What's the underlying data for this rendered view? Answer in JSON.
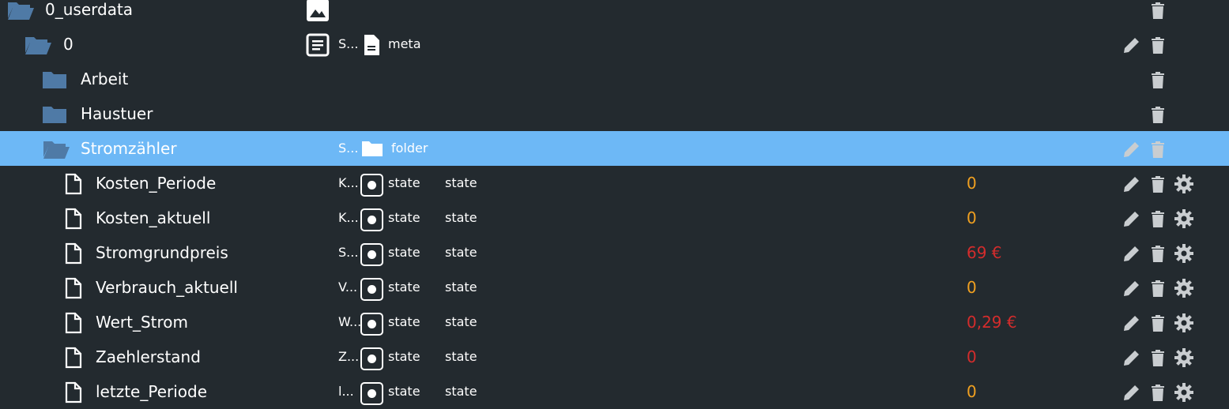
{
  "colors": {
    "background": "#232a2f",
    "selected_row": "#6db8f6",
    "folder_icon": "#4f7aa6",
    "action_icon": "#c9cdd0",
    "value_orange": "#f0a020",
    "value_red": "#d42c2c"
  },
  "rows": [
    {
      "name": "0_userdata",
      "icon": "folder-open-icon",
      "type_icon": "image-icon"
    },
    {
      "name": "0",
      "icon": "folder-open-icon",
      "label": "S...",
      "type_icon": "document-icon",
      "type_label": "meta"
    },
    {
      "name": "Arbeit",
      "icon": "folder-icon"
    },
    {
      "name": "Haustuer",
      "icon": "folder-icon"
    },
    {
      "name": "Stromzähler",
      "icon": "folder-open-icon",
      "label": "S...",
      "type_icon": "folder-icon",
      "type_label": "folder",
      "selected": true
    },
    {
      "name": "Kosten_Periode",
      "icon": "file-icon",
      "label": "K...",
      "type_label": "state",
      "role": "state",
      "value": "0",
      "value_color": "orange"
    },
    {
      "name": "Kosten_aktuell",
      "icon": "file-icon",
      "label": "K...",
      "type_label": "state",
      "role": "state",
      "value": "0",
      "value_color": "orange"
    },
    {
      "name": "Stromgrundpreis",
      "icon": "file-icon",
      "label": "S...",
      "type_label": "state",
      "role": "state",
      "value": "69 €",
      "value_color": "red"
    },
    {
      "name": "Verbrauch_aktuell",
      "icon": "file-icon",
      "label": "V...",
      "type_label": "state",
      "role": "state",
      "value": "0",
      "value_color": "orange"
    },
    {
      "name": "Wert_Strom",
      "icon": "file-icon",
      "label": "W...",
      "type_label": "state",
      "role": "state",
      "value": "0,29 €",
      "value_color": "red"
    },
    {
      "name": "Zaehlerstand",
      "icon": "file-icon",
      "label": "Z...",
      "type_label": "state",
      "role": "state",
      "value": "0",
      "value_color": "red"
    },
    {
      "name": "letzte_Periode",
      "icon": "file-icon",
      "label": "l...",
      "type_label": "state",
      "role": "state",
      "value": "0",
      "value_color": "orange"
    }
  ]
}
